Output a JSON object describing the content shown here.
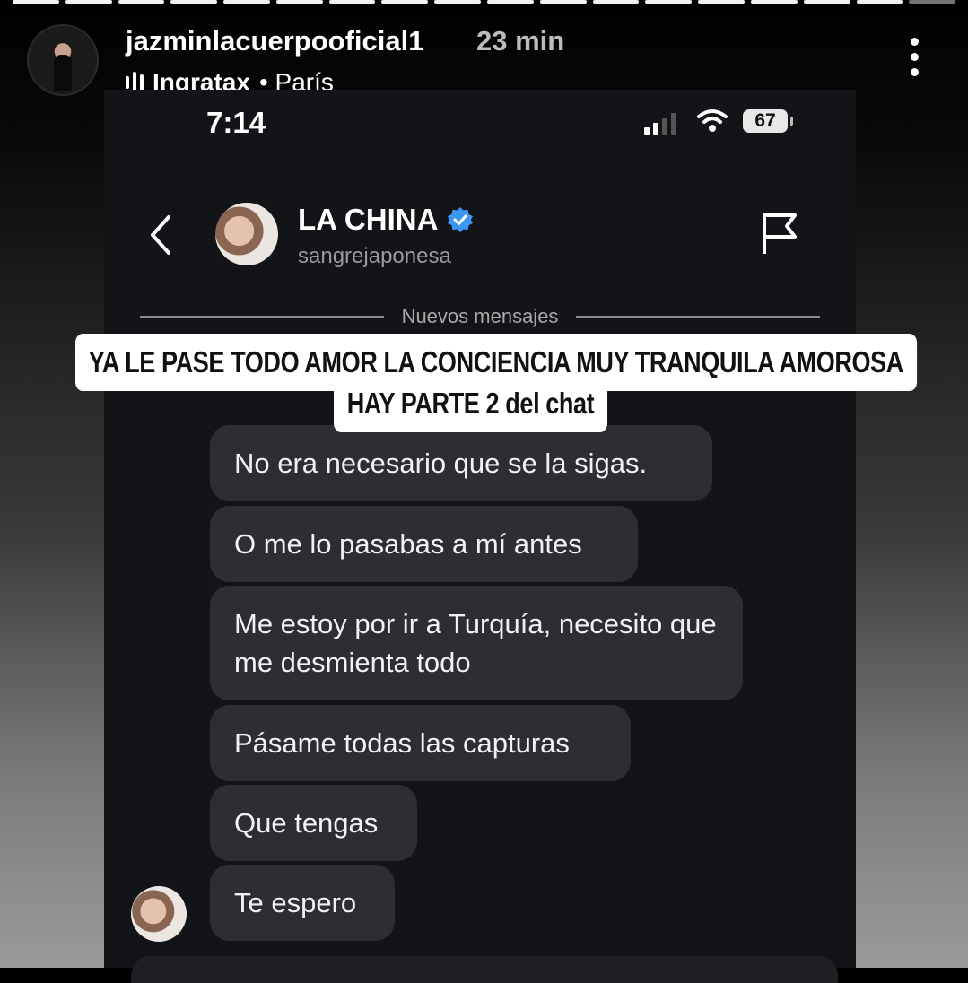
{
  "story": {
    "username": "jazminlacuerpooficial1",
    "time_ago": "23 min",
    "music": {
      "artist": "Ingratax",
      "location": "• París"
    },
    "segments_total": 18,
    "segments_active": 17
  },
  "screenshot": {
    "status": {
      "time": "7:14",
      "battery": "67"
    },
    "chat": {
      "name": "LA CHINA",
      "handle": "sangrejaponesa"
    },
    "divider": "Nuevos mensajes",
    "messages": [
      "No era necesario que se la sigas.",
      "O me lo pasabas a mí antes",
      "Me estoy por ir a Turquía, necesito que me desmienta todo",
      "Pásame todas las capturas",
      "Que tengas",
      "Te espero"
    ]
  },
  "caption": {
    "line1": "YA LE PASE TODO AMOR LA CONCIENCIA MUY TRANQUILA AMOROSA",
    "line2": "HAY PARTE 2 del chat"
  },
  "colors": {
    "verified": "#3b97f3",
    "bubble": "#2c2e33",
    "chat_bg": "#121418"
  },
  "icons": [
    "back-chevron-icon",
    "verified-icon",
    "flag-icon",
    "wifi-icon",
    "signal-icon",
    "battery-icon",
    "more-icon",
    "audio-bars-icon"
  ]
}
